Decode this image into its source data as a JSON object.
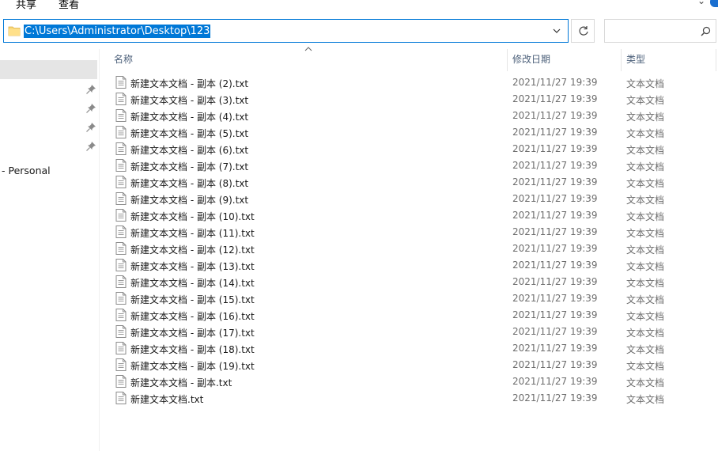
{
  "ribbon": {
    "tabs": [
      "共享",
      "查看"
    ]
  },
  "address": {
    "path": "C:\\Users\\Administrator\\Desktop\\123"
  },
  "search": {
    "placeholder": ""
  },
  "nav": {
    "personal_label": "- Personal"
  },
  "columns": {
    "name": "名称",
    "date": "修改日期",
    "type": "类型"
  },
  "files": [
    {
      "name": "新建文本文档 - 副本 (2).txt",
      "date": "2021/11/27 19:39",
      "type": "文本文档"
    },
    {
      "name": "新建文本文档 - 副本 (3).txt",
      "date": "2021/11/27 19:39",
      "type": "文本文档"
    },
    {
      "name": "新建文本文档 - 副本 (4).txt",
      "date": "2021/11/27 19:39",
      "type": "文本文档"
    },
    {
      "name": "新建文本文档 - 副本 (5).txt",
      "date": "2021/11/27 19:39",
      "type": "文本文档"
    },
    {
      "name": "新建文本文档 - 副本 (6).txt",
      "date": "2021/11/27 19:39",
      "type": "文本文档"
    },
    {
      "name": "新建文本文档 - 副本 (7).txt",
      "date": "2021/11/27 19:39",
      "type": "文本文档"
    },
    {
      "name": "新建文本文档 - 副本 (8).txt",
      "date": "2021/11/27 19:39",
      "type": "文本文档"
    },
    {
      "name": "新建文本文档 - 副本 (9).txt",
      "date": "2021/11/27 19:39",
      "type": "文本文档"
    },
    {
      "name": "新建文本文档 - 副本 (10).txt",
      "date": "2021/11/27 19:39",
      "type": "文本文档"
    },
    {
      "name": "新建文本文档 - 副本 (11).txt",
      "date": "2021/11/27 19:39",
      "type": "文本文档"
    },
    {
      "name": "新建文本文档 - 副本 (12).txt",
      "date": "2021/11/27 19:39",
      "type": "文本文档"
    },
    {
      "name": "新建文本文档 - 副本 (13).txt",
      "date": "2021/11/27 19:39",
      "type": "文本文档"
    },
    {
      "name": "新建文本文档 - 副本 (14).txt",
      "date": "2021/11/27 19:39",
      "type": "文本文档"
    },
    {
      "name": "新建文本文档 - 副本 (15).txt",
      "date": "2021/11/27 19:39",
      "type": "文本文档"
    },
    {
      "name": "新建文本文档 - 副本 (16).txt",
      "date": "2021/11/27 19:39",
      "type": "文本文档"
    },
    {
      "name": "新建文本文档 - 副本 (17).txt",
      "date": "2021/11/27 19:39",
      "type": "文本文档"
    },
    {
      "name": "新建文本文档 - 副本 (18).txt",
      "date": "2021/11/27 19:39",
      "type": "文本文档"
    },
    {
      "name": "新建文本文档 - 副本 (19).txt",
      "date": "2021/11/27 19:39",
      "type": "文本文档"
    },
    {
      "name": "新建文本文档 - 副本.txt",
      "date": "2021/11/27 19:39",
      "type": "文本文档"
    },
    {
      "name": "新建文本文档.txt",
      "date": "2021/11/27 19:39",
      "type": "文本文档"
    }
  ],
  "icons": {
    "folder": "folder-icon",
    "refresh": "refresh-icon",
    "search": "search-icon",
    "pin": "pin-icon",
    "file": "text-file-icon"
  },
  "colors": {
    "accent": "#0078d7",
    "header_text": "#4c607a",
    "secondary_text": "#6d6d6d",
    "nav_selected": "#e5e5e5"
  }
}
